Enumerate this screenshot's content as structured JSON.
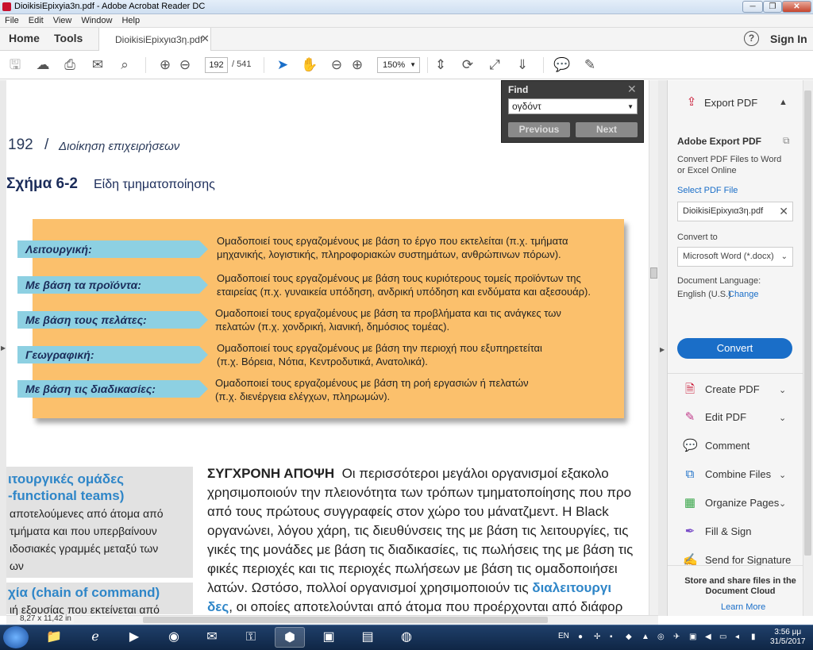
{
  "window": {
    "title": "DioikisiEpixyia3n.pdf - Adobe Acrobat Reader DC",
    "minimize": "─",
    "maximize": "❐",
    "close": "✕"
  },
  "menu": [
    "File",
    "Edit",
    "View",
    "Window",
    "Help"
  ],
  "tabs": {
    "home": "Home",
    "tools": "Tools",
    "doc_tab": "DioikisiEpixyια3η.pdf",
    "help": "?",
    "sign_in": "Sign In"
  },
  "toolbar": {
    "page_current": "192",
    "page_total": "/ 541",
    "zoom": "150%"
  },
  "find": {
    "title": "Find",
    "query": "ογδόντ",
    "previous": "Previous",
    "next": "Next"
  },
  "document": {
    "page_number": "192",
    "slash": "/",
    "running_header": "Διοίκηση επιχειρήσεων",
    "figure_label": "Σχήμα 6-2",
    "figure_title": "Είδη τμηματοποίησης",
    "rows": [
      {
        "label": "Λειτουργική:",
        "line1": "Ομαδοποιεί τους εργαζομένους με βάση το έργο που εκτελείται (π.χ. τμήματα",
        "line2": "μηχανικής, λογιστικής, πληροφοριακών συστημάτων, ανθρώπινων πόρων)."
      },
      {
        "label": "Με βάση τα προϊόντα:",
        "line1": "Ομαδοποιεί τους εργαζομένους με βάση τους κυριότερους τομείς προϊόντων της",
        "line2": "εταιρείας (π.χ. γυναικεία υπόδηση, ανδρική υπόδηση και ενδύματα και αξεσουάρ)."
      },
      {
        "label": "Με βάση τους πελάτες:",
        "line1": "Ομαδοποιεί τους εργαζομένους με βάση τα προβλήματα και τις ανάγκες των",
        "line2": "πελατών (π.χ. χονδρική, λιανική, δημόσιος τομέας)."
      },
      {
        "label": "Γεωγραφική:",
        "line1": "Ομαδοποιεί τους εργαζομένους με βάση την περιοχή που εξυπηρετείται",
        "line2": "(π.χ. Βόρεια, Νότια, Κεντροδυτικά, Ανατολικά)."
      },
      {
        "label": "Με βάση τις διαδικασίες:",
        "line1": "Ομαδοποιεί τους εργαζομένους με βάση τη ροή εργασιών ή πελατών",
        "line2": "(π.χ. διενέργεια ελέγχων, πληρωμών)."
      }
    ],
    "sidebar_title1": "ιτουργικές ομάδες",
    "sidebar_title2": "-functional teams)",
    "sidebar_lines": [
      "αποτελούμενες από άτομα από",
      "τμήματα και που υπερβαίνουν",
      "ιδοσιακές γραμμές μεταξύ των",
      "ων"
    ],
    "sidebar2_title": "χία (chain of command)",
    "sidebar2_line": "ιή εξουσίας που εκτείνεται από",
    "body_lead": "ΣΥΓΧΡΟΝΗ ΑΠΟΨΗ",
    "body_first": "Οι περισσότεροι μεγάλοι οργανισμοί εξακολο",
    "body_lines": [
      "χρησιμοποιούν την πλειονότητα των τρόπων τμηματοποίησης που προ",
      "από τους πρώτους συγγραφείς στον χώρο του μάνατζμεντ. Η Black",
      "οργανώνει, λόγου χάρη, τις διευθύνσεις της με βάση τις λειτουργίες, τις",
      "γικές της μονάδες με βάση τις διαδικασίες, τις πωλήσεις της με βάση τις",
      "φικές περιοχές και τις περιοχές πωλήσεων με βάση τις ομαδοποιήσει",
      "λατών. Ωστόσο, πολλοί οργανισμοί χρησιμοποιούν τις"
    ],
    "body_blue": "διαλειτουργι",
    "body_last_blue": "δες",
    "body_last": ", οι οποίες αποτελούνται από άτομα που προέρχονται από διάφορ",
    "page_size": "8,27 x 11,42 in"
  },
  "right_pane": {
    "export_header": "Export PDF",
    "adobe_export": "Adobe Export PDF",
    "description": "Convert PDF Files to Word or Excel Online",
    "select_pdf": "Select PDF File",
    "file_name": "DioikisiEpixyια3η.pdf",
    "convert_to": "Convert to",
    "format": "Microsoft Word (*.docx)",
    "doc_language": "Document Language:",
    "language": "English (U.S.)",
    "change": "Change",
    "convert_button": "Convert",
    "tools": [
      "Create PDF",
      "Edit PDF",
      "Comment",
      "Combine Files",
      "Organize Pages",
      "Fill & Sign",
      "Send for Signature"
    ],
    "share_text": "Store and share files in the Document Cloud",
    "learn_more": "Learn More"
  },
  "taskbar": {
    "language": "EN",
    "time": "3:56 μμ",
    "date": "31/5/2017"
  },
  "colors": {
    "accent": "#1a6ec8",
    "figure_bg": "#fbc06c",
    "label_bg": "#8dd0e2",
    "sidebar_blue": "#2f86c8"
  }
}
